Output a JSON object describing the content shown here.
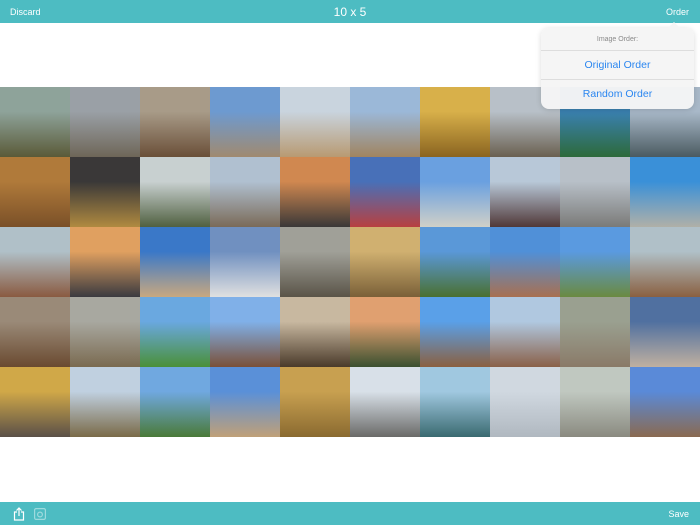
{
  "header": {
    "discard_label": "Discard",
    "title": "10 x 5",
    "order_label": "Order"
  },
  "popover": {
    "title": "Image Order:",
    "options": [
      "Original Order",
      "Random Order"
    ],
    "accent": "#2a86f0"
  },
  "footer": {
    "save_label": "Save",
    "icons": [
      "share-icon",
      "instagram-icon"
    ]
  },
  "colors": {
    "bar": "#4dbcc2"
  },
  "tiles": [
    [
      "#8ea39a",
      "#5a5a38"
    ],
    [
      "#9aa0a6",
      "#6e6658"
    ],
    [
      "#a89b88",
      "#6a4f38"
    ],
    [
      "#6d9ad0",
      "#a08a70"
    ],
    [
      "#c9d4de",
      "#b89a72"
    ],
    [
      "#9bb8d8",
      "#a08460"
    ],
    [
      "#d8b04a",
      "#8a6420"
    ],
    [
      "#b8c0c8",
      "#6a6050"
    ],
    [
      "#3a80b0",
      "#2d6a3a"
    ],
    [
      "#a8b8c8",
      "#4a5a60"
    ],
    [
      "#b07a3a",
      "#7a5028"
    ],
    [
      "#3a3838",
      "#b08a40"
    ],
    [
      "#c8d0d0",
      "#506040"
    ],
    [
      "#b0c0d0",
      "#7a6a58"
    ],
    [
      "#d08850",
      "#3a3838"
    ],
    [
      "#4870b8",
      "#b84040"
    ],
    [
      "#6aa0e0",
      "#d0d0c8"
    ],
    [
      "#b8c8d8",
      "#503838"
    ],
    [
      "#b8c0c8",
      "#7a7a78"
    ],
    [
      "#3a90d8",
      "#b0b0a8"
    ],
    [
      "#b0c0c8",
      "#8a5a40"
    ],
    [
      "#e0a060",
      "#3a3a40"
    ],
    [
      "#3a78c8",
      "#c8a880"
    ],
    [
      "#7090c0",
      "#e0e0e0"
    ],
    [
      "#a0a098",
      "#5a5448"
    ],
    [
      "#d0b070",
      "#7a6038"
    ],
    [
      "#5a98d8",
      "#4a7030"
    ],
    [
      "#5090d8",
      "#a87050"
    ],
    [
      "#5a9ae0",
      "#6a8a40"
    ],
    [
      "#b0c0c8",
      "#8a6040"
    ],
    [
      "#9a8a78",
      "#6a4a30"
    ],
    [
      "#a8a8a0",
      "#7a6a50"
    ],
    [
      "#6aa8e0",
      "#4a9038"
    ],
    [
      "#80b0e8",
      "#7a5038"
    ],
    [
      "#c8b8a0",
      "#4a3a2a"
    ],
    [
      "#e0a070",
      "#3a5030"
    ],
    [
      "#5aa0e8",
      "#8a6040"
    ],
    [
      "#b0c8e0",
      "#8a6048"
    ],
    [
      "#9aa090",
      "#8a7a68"
    ],
    [
      "#5070a0",
      "#c0b0a0"
    ],
    [
      "#d0a848",
      "#5a5048"
    ],
    [
      "#c0d0e0",
      "#7a6a48"
    ],
    [
      "#70a8e0",
      "#4a7a38"
    ],
    [
      "#5a90d8",
      "#c0a078"
    ],
    [
      "#c8a050",
      "#8a6a30"
    ],
    [
      "#d8e0e8",
      "#6a6a68"
    ],
    [
      "#a0c8e0",
      "#3a6a70"
    ],
    [
      "#d0d8e0",
      "#b0b8c0"
    ],
    [
      "#c0c8c0",
      "#8a8a80"
    ],
    [
      "#5a8ad8",
      "#8a6a50"
    ]
  ]
}
